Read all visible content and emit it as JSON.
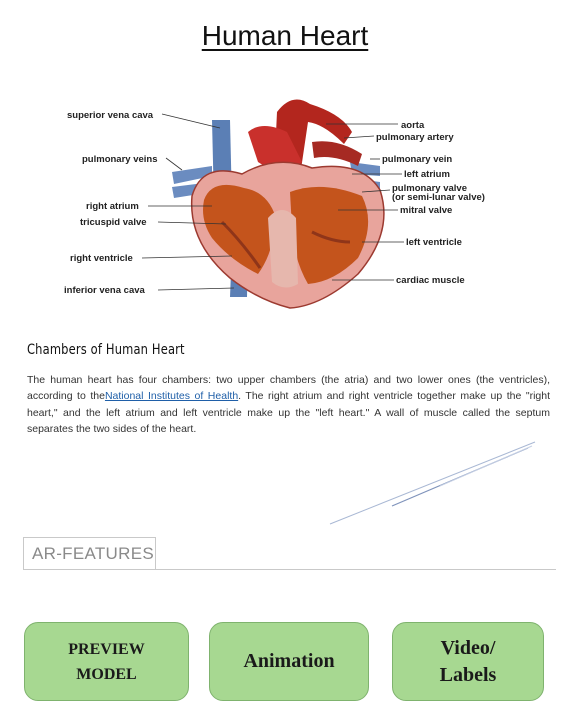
{
  "page_title": "Human Heart",
  "diagram": {
    "labels_left": [
      "superior vena cava",
      "pulmonary veins",
      "right atrium",
      "tricuspid valve",
      "right ventricle",
      "inferior vena cava"
    ],
    "labels_right": [
      "aorta",
      "pulmonary artery",
      "pulmonary vein",
      "left atrium",
      "pulmonary valve",
      "(or semi-lunar valve)",
      "mitral valve",
      "left ventricle",
      "cardiac muscle"
    ]
  },
  "article": {
    "heading": "Chambers of Human Heart",
    "text_before_link": "The human heart has four chambers: two upper chambers (the atria) and two lower ones (the ventricles), according to the",
    "link_text": "National Institutes of Health",
    "text_after_link": ". The right atrium and right ventricle together make up the \"right heart,\" and the left atrium and left ventricle make up the \"left heart.\" A wall of muscle called the septum separates the two sides of the heart."
  },
  "ar_features": {
    "label": "AR-FEATURES"
  },
  "buttons": {
    "preview": "PREVIEW\nMODEL",
    "animation": "Animation",
    "video": "Video/\nLabels"
  },
  "colors": {
    "button_fill": "#a7d891",
    "button_border": "#7fb36e",
    "link": "#1f5fa8",
    "heart_red": "#c0392b",
    "vessel_blue": "#5b7fb5"
  }
}
